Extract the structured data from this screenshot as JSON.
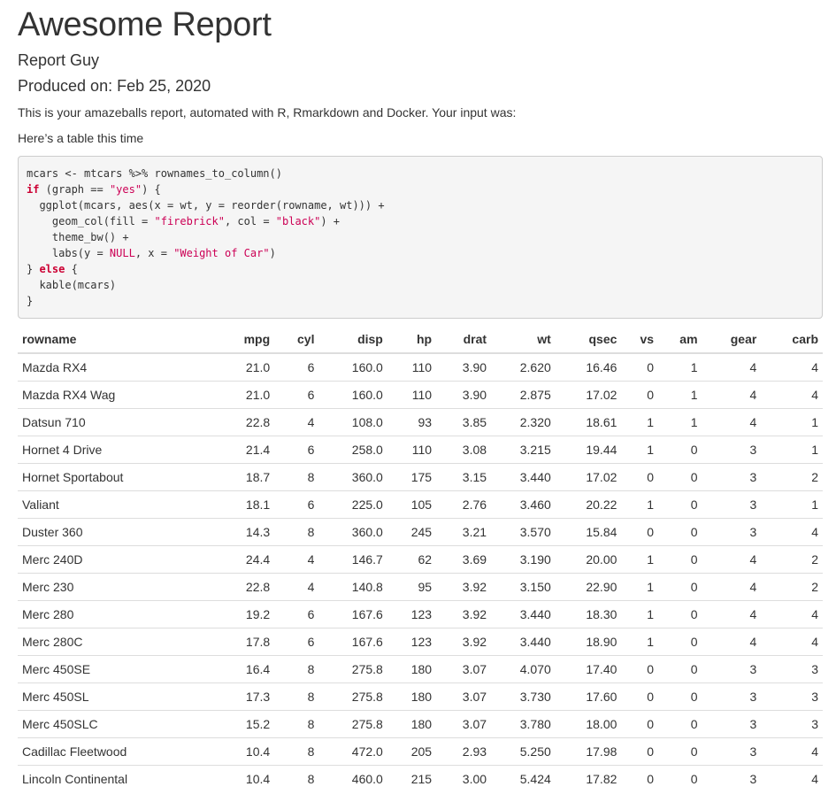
{
  "title": "Awesome Report",
  "author": "Report Guy",
  "date_line": "Produced on: Feb 25, 2020",
  "intro": "This is your amazeballs report, automated with R, Rmarkdown and Docker. Your input was:",
  "table_note": "Here’s a table this time",
  "code": {
    "line1": "mcars <- mtcars %>% rownames_to_column()",
    "if_kw": "if",
    "l2_a": " (graph == ",
    "l2_str": "\"yes\"",
    "l2_b": ") {",
    "line3": "  ggplot(mcars, aes(x = wt, y = reorder(rowname, wt))) +",
    "l4_a": "    geom_col(fill = ",
    "l4_str1": "\"firebrick\"",
    "l4_b": ", col = ",
    "l4_str2": "\"black\"",
    "l4_c": ") +",
    "line5": "    theme_bw() +",
    "l6_a": "    labs(y = ",
    "l6_null": "NULL",
    "l6_b": ", x = ",
    "l6_str": "\"Weight of Car\"",
    "l6_c": ")",
    "l7_a": "} ",
    "else_kw": "else",
    "l7_b": " {",
    "line8": "  kable(mcars)",
    "line9": "}"
  },
  "table": {
    "headers": [
      "rowname",
      "mpg",
      "cyl",
      "disp",
      "hp",
      "drat",
      "wt",
      "qsec",
      "vs",
      "am",
      "gear",
      "carb"
    ],
    "rows": [
      [
        "Mazda RX4",
        "21.0",
        "6",
        "160.0",
        "110",
        "3.90",
        "2.620",
        "16.46",
        "0",
        "1",
        "4",
        "4"
      ],
      [
        "Mazda RX4 Wag",
        "21.0",
        "6",
        "160.0",
        "110",
        "3.90",
        "2.875",
        "17.02",
        "0",
        "1",
        "4",
        "4"
      ],
      [
        "Datsun 710",
        "22.8",
        "4",
        "108.0",
        "93",
        "3.85",
        "2.320",
        "18.61",
        "1",
        "1",
        "4",
        "1"
      ],
      [
        "Hornet 4 Drive",
        "21.4",
        "6",
        "258.0",
        "110",
        "3.08",
        "3.215",
        "19.44",
        "1",
        "0",
        "3",
        "1"
      ],
      [
        "Hornet Sportabout",
        "18.7",
        "8",
        "360.0",
        "175",
        "3.15",
        "3.440",
        "17.02",
        "0",
        "0",
        "3",
        "2"
      ],
      [
        "Valiant",
        "18.1",
        "6",
        "225.0",
        "105",
        "2.76",
        "3.460",
        "20.22",
        "1",
        "0",
        "3",
        "1"
      ],
      [
        "Duster 360",
        "14.3",
        "8",
        "360.0",
        "245",
        "3.21",
        "3.570",
        "15.84",
        "0",
        "0",
        "3",
        "4"
      ],
      [
        "Merc 240D",
        "24.4",
        "4",
        "146.7",
        "62",
        "3.69",
        "3.190",
        "20.00",
        "1",
        "0",
        "4",
        "2"
      ],
      [
        "Merc 230",
        "22.8",
        "4",
        "140.8",
        "95",
        "3.92",
        "3.150",
        "22.90",
        "1",
        "0",
        "4",
        "2"
      ],
      [
        "Merc 280",
        "19.2",
        "6",
        "167.6",
        "123",
        "3.92",
        "3.440",
        "18.30",
        "1",
        "0",
        "4",
        "4"
      ],
      [
        "Merc 280C",
        "17.8",
        "6",
        "167.6",
        "123",
        "3.92",
        "3.440",
        "18.90",
        "1",
        "0",
        "4",
        "4"
      ],
      [
        "Merc 450SE",
        "16.4",
        "8",
        "275.8",
        "180",
        "3.07",
        "4.070",
        "17.40",
        "0",
        "0",
        "3",
        "3"
      ],
      [
        "Merc 450SL",
        "17.3",
        "8",
        "275.8",
        "180",
        "3.07",
        "3.730",
        "17.60",
        "0",
        "0",
        "3",
        "3"
      ],
      [
        "Merc 450SLC",
        "15.2",
        "8",
        "275.8",
        "180",
        "3.07",
        "3.780",
        "18.00",
        "0",
        "0",
        "3",
        "3"
      ],
      [
        "Cadillac Fleetwood",
        "10.4",
        "8",
        "472.0",
        "205",
        "2.93",
        "5.250",
        "17.98",
        "0",
        "0",
        "3",
        "4"
      ],
      [
        "Lincoln Continental",
        "10.4",
        "8",
        "460.0",
        "215",
        "3.00",
        "5.424",
        "17.82",
        "0",
        "0",
        "3",
        "4"
      ]
    ]
  }
}
